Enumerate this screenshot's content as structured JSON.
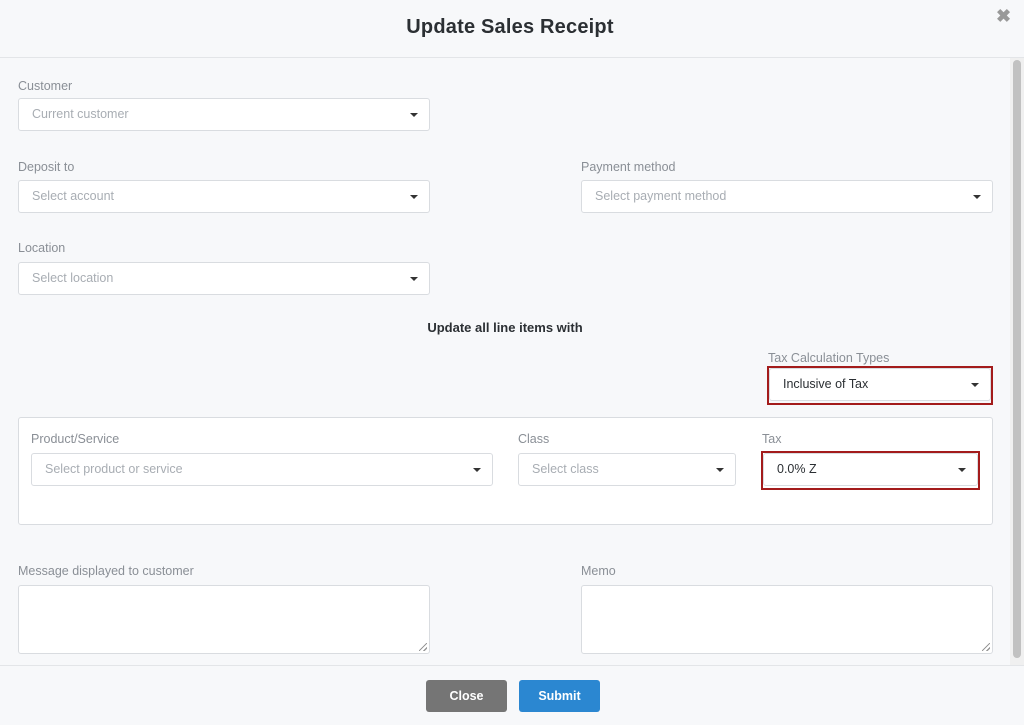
{
  "dialog": {
    "title": "Update Sales Receipt",
    "close_icon": "close-icon",
    "close_glyph": "✖"
  },
  "customer": {
    "label": "Customer",
    "placeholder": "Current customer"
  },
  "deposit_to": {
    "label": "Deposit to",
    "placeholder": "Select account"
  },
  "payment_method": {
    "label": "Payment method",
    "placeholder": "Select payment method"
  },
  "location": {
    "label": "Location",
    "placeholder": "Select location"
  },
  "line_items": {
    "heading": "Update all line items with",
    "tax_calc": {
      "label": "Tax Calculation Types",
      "value": "Inclusive of Tax"
    },
    "product": {
      "label": "Product/Service",
      "placeholder": "Select product or service"
    },
    "class": {
      "label": "Class",
      "placeholder": "Select class"
    },
    "tax": {
      "label": "Tax",
      "value": "0.0% Z"
    }
  },
  "message": {
    "label": "Message displayed to customer",
    "value": ""
  },
  "memo": {
    "label": "Memo",
    "value": ""
  },
  "footer": {
    "close_label": "Close",
    "submit_label": "Submit"
  },
  "colors": {
    "highlight": "#a31b1b",
    "submit": "#2b87d1",
    "close": "#757575"
  }
}
